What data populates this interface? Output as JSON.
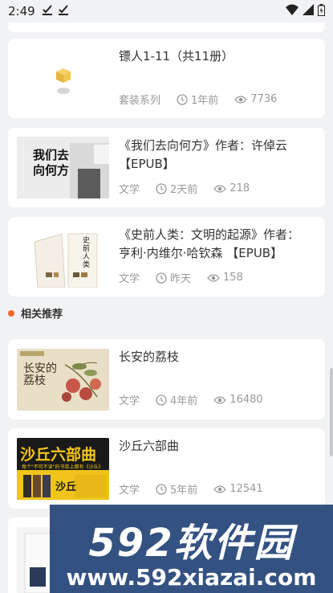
{
  "status_bar": {
    "time": "2:49"
  },
  "items": [
    {
      "title": "镖人1-11（共11册）",
      "category": "套装系列",
      "time": "1年前",
      "views": "7736"
    },
    {
      "title": "《我们去向何方》作者：许倬云【EPUB】",
      "category": "文学",
      "time": "2天前",
      "views": "218",
      "cover_text": "我们去向何方"
    },
    {
      "title": "《史前人类：文明的起源》作者：亨利·内维尔·哈钦森 【EPUB】",
      "category": "文学",
      "time": "昨天",
      "views": "158",
      "cover_text": "史前人类"
    }
  ],
  "section": {
    "title": "相关推荐"
  },
  "recommended": [
    {
      "title": "长安的荔枝",
      "category": "文学",
      "time": "4年前",
      "views": "16480",
      "cover_text": "长安的荔枝"
    },
    {
      "title": "沙丘六部曲",
      "category": "文学",
      "time": "5年前",
      "views": "12541",
      "cover_text": "沙丘六部曲",
      "cover_sub": "每个\"不可不读\"的书单上都有《沙丘》",
      "cover_small": "沙丘"
    }
  ],
  "watermark": {
    "logo": "592软件园",
    "url": "www.592xiazai.com"
  },
  "colors": {
    "accent": "#f06a2e",
    "meta": "#999999",
    "background": "#f1f2f4"
  }
}
